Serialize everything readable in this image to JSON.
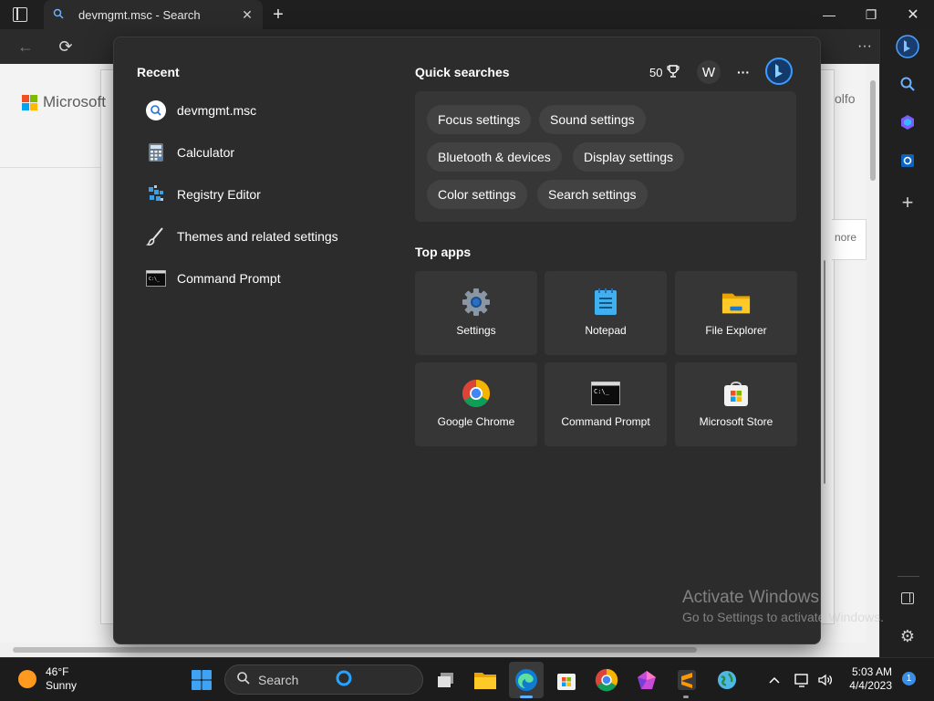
{
  "browser": {
    "tab_title": "devmgmt.msc - Search",
    "page_peek_right": "olfo",
    "page_peek_more": "nore",
    "brand": "Microsoft"
  },
  "flyout": {
    "recent_title": "Recent",
    "recent": [
      {
        "label": "devmgmt.msc",
        "icon": "search-icon"
      },
      {
        "label": "Calculator",
        "icon": "calculator-icon"
      },
      {
        "label": "Registry Editor",
        "icon": "registry-editor-icon"
      },
      {
        "label": "Themes and related settings",
        "icon": "brush-icon"
      },
      {
        "label": "Command Prompt",
        "icon": "command-prompt-icon"
      }
    ],
    "quick_searches_title": "Quick searches",
    "rewards_points": "50",
    "account_initial": "W",
    "more_label": "···",
    "quick_searches": [
      "Focus settings",
      "Sound settings",
      "Bluetooth & devices",
      "Display settings",
      "Color settings",
      "Search settings"
    ],
    "top_apps_title": "Top apps",
    "top_apps": [
      {
        "label": "Settings",
        "icon": "settings-gear-icon"
      },
      {
        "label": "Notepad",
        "icon": "notepad-icon"
      },
      {
        "label": "File Explorer",
        "icon": "file-explorer-icon"
      },
      {
        "label": "Google Chrome",
        "icon": "chrome-icon"
      },
      {
        "label": "Command Prompt",
        "icon": "command-prompt-icon"
      },
      {
        "label": "Microsoft Store",
        "icon": "microsoft-store-icon"
      }
    ]
  },
  "watermark": {
    "line1": "Activate Windows",
    "line2": "Go to Settings to activate Windows."
  },
  "taskbar": {
    "temperature": "46°F",
    "condition": "Sunny",
    "search_placeholder": "Search",
    "time": "5:03 AM",
    "date": "4/4/2023",
    "notification_count": "1"
  },
  "colors": {
    "accent": "#3a8ee6",
    "flyout_bg": "#2c2c2c",
    "chip_bg": "#424242",
    "taskbar_bg": "#1c1c1c"
  }
}
